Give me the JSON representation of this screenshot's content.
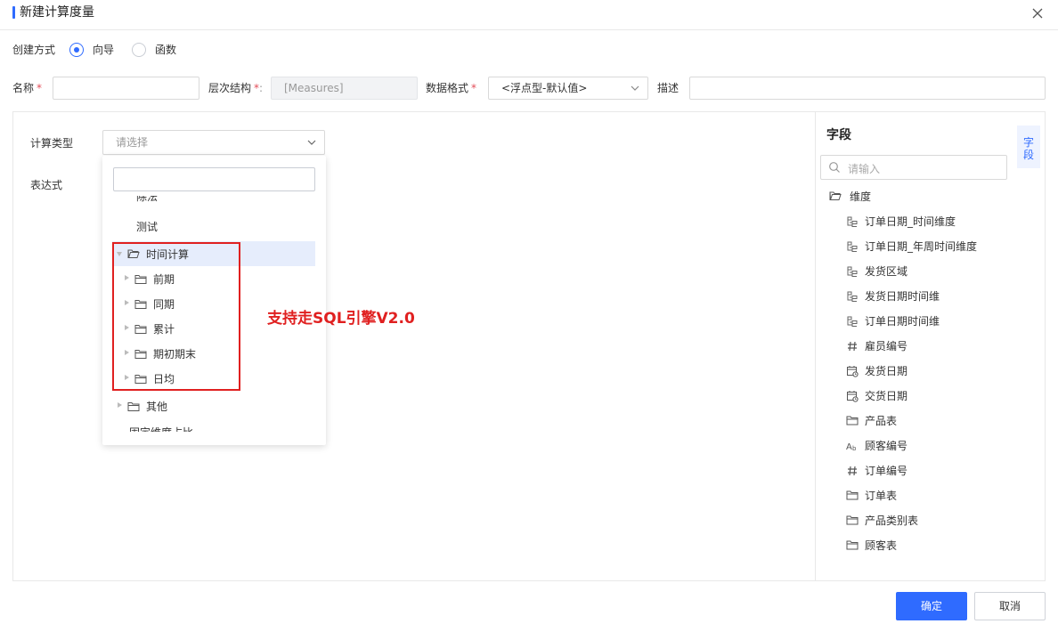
{
  "dialog": {
    "title": "新建计算度量"
  },
  "create_mode": {
    "label": "创建方式",
    "options": [
      {
        "label": "向导",
        "selected": true
      },
      {
        "label": "函数",
        "selected": false
      }
    ]
  },
  "form": {
    "name_label": "名称",
    "name_value": "",
    "hierarchy_label": "层次结构",
    "hierarchy_value": "[Measures]",
    "format_label": "数据格式",
    "format_value": "<浮点型-默认值>",
    "desc_label": "描述",
    "desc_value": "",
    "required_mark": "*"
  },
  "calc": {
    "type_label": "计算类型",
    "type_placeholder": "请选择",
    "expr_label": "表达式"
  },
  "dropdown": {
    "search_placeholder": "",
    "items": {
      "partial_top": "除法",
      "test": "测试",
      "time_calc": "时间计算",
      "prev_period": "前期",
      "same_period": "同期",
      "cumulative": "累计",
      "period_start_end": "期初期末",
      "daily_avg": "日均",
      "other": "其他",
      "partial_bottom": "固定维度占比"
    }
  },
  "annotation": {
    "text": "支持走SQL引擎V2.0",
    "color": "#e02020"
  },
  "field_panel": {
    "title": "字段",
    "tab_label": "字段",
    "search_placeholder": "请输入",
    "root": "维度",
    "items": [
      {
        "label": "订单日期_时间维度",
        "icon": "hierarchy-icon"
      },
      {
        "label": "订单日期_年周时间维度",
        "icon": "hierarchy-icon"
      },
      {
        "label": "发货区域",
        "icon": "hierarchy-icon"
      },
      {
        "label": "发货日期时间维",
        "icon": "hierarchy-icon"
      },
      {
        "label": "订单日期时间维",
        "icon": "hierarchy-icon"
      },
      {
        "label": "雇员编号",
        "icon": "number-icon"
      },
      {
        "label": "发货日期",
        "icon": "date-icon"
      },
      {
        "label": "交货日期",
        "icon": "date-icon"
      },
      {
        "label": "产品表",
        "icon": "folder-icon"
      },
      {
        "label": "顾客编号",
        "icon": "text-icon"
      },
      {
        "label": "订单编号",
        "icon": "number-icon"
      },
      {
        "label": "订单表",
        "icon": "folder-icon"
      },
      {
        "label": "产品类别表",
        "icon": "folder-icon"
      },
      {
        "label": "顾客表",
        "icon": "folder-icon"
      }
    ]
  },
  "footer": {
    "confirm": "确定",
    "cancel": "取消"
  },
  "colors": {
    "primary": "#2f6bff",
    "highlight": "#e6edfc",
    "required": "#e34d59"
  }
}
